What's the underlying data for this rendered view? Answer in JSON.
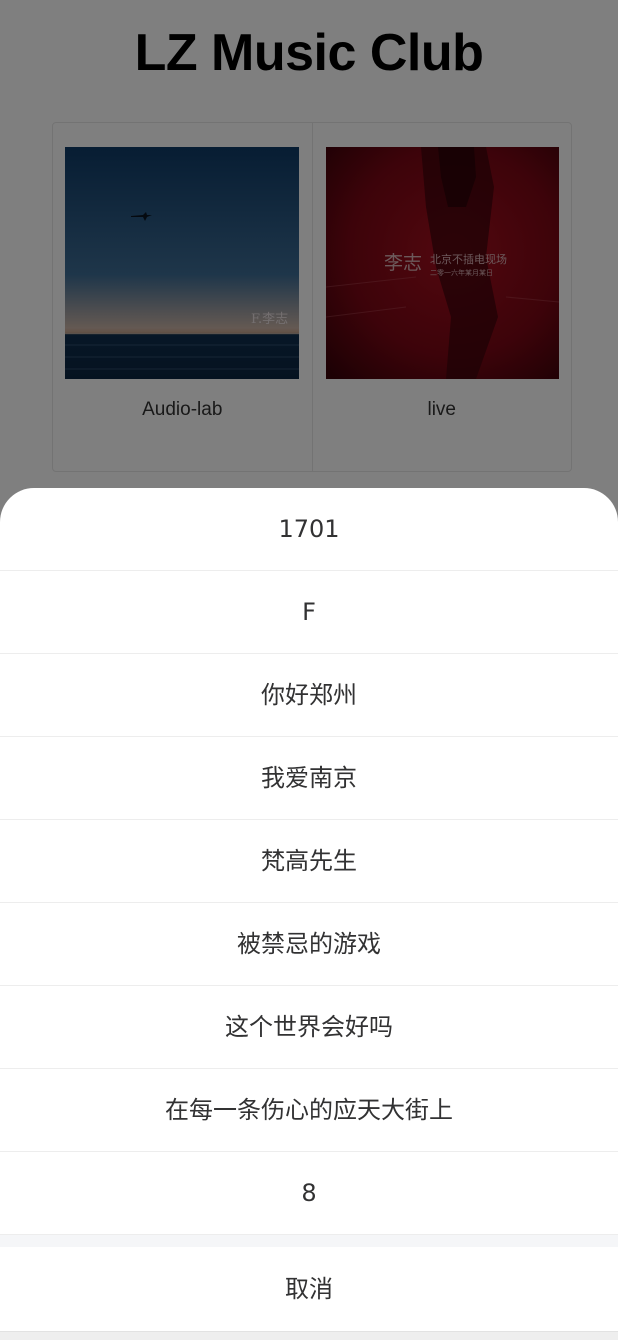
{
  "app": {
    "title": "LZ Music Club"
  },
  "albums": [
    {
      "name": "Audio-lab",
      "cover_text": "F.李志"
    },
    {
      "name": "live",
      "cover_text_artist": "李志",
      "cover_text_title": "北京不插电现场",
      "cover_text_sub": "二零一六年某月某日"
    }
  ],
  "action_sheet": {
    "items": [
      "1701",
      "F",
      "你好郑州",
      "我爱南京",
      "梵高先生",
      "被禁忌的游戏",
      "这个世界会好吗",
      "在每一条伤心的应天大街上",
      "8"
    ],
    "cancel_label": "取消"
  },
  "colors": {
    "mask": "#000000",
    "sheet_bg": "#ffffff",
    "text": "#323233",
    "divider": "#ededed",
    "gap": "#f5f6f8"
  }
}
